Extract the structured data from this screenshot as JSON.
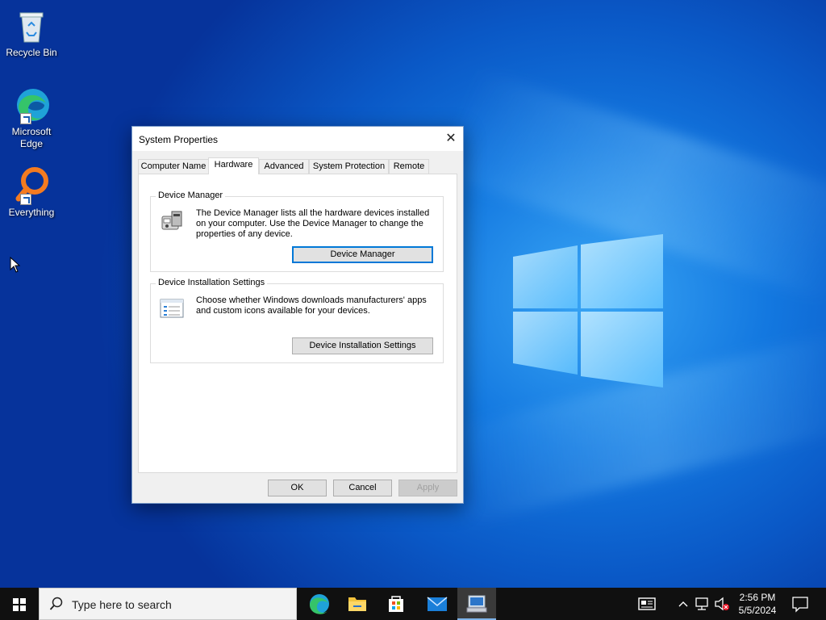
{
  "desktop": {
    "icons": [
      {
        "label": "Recycle Bin"
      },
      {
        "label": "Microsoft Edge"
      },
      {
        "label": "Everything"
      }
    ]
  },
  "dialog": {
    "title": "System Properties",
    "close_label": "✕",
    "tabs": [
      {
        "label": "Computer Name"
      },
      {
        "label": "Hardware"
      },
      {
        "label": "Advanced"
      },
      {
        "label": "System Protection"
      },
      {
        "label": "Remote"
      }
    ],
    "active_tab": "Hardware",
    "device_manager": {
      "title": "Device Manager",
      "description": "The Device Manager lists all the hardware devices installed on your computer. Use the Device Manager to change the properties of any device.",
      "button": "Device Manager"
    },
    "device_installation": {
      "title": "Device Installation Settings",
      "description": "Choose whether Windows downloads manufacturers' apps and custom icons available for your devices.",
      "button": "Device Installation Settings"
    },
    "buttons": {
      "ok": "OK",
      "cancel": "Cancel",
      "apply": "Apply"
    }
  },
  "taskbar": {
    "search_placeholder": "Type here to search",
    "time": "2:56 PM",
    "date": "5/5/2024"
  },
  "colors": {
    "accent": "#0078d7",
    "taskbar": "#101010",
    "desktop": "#0a58c6"
  }
}
